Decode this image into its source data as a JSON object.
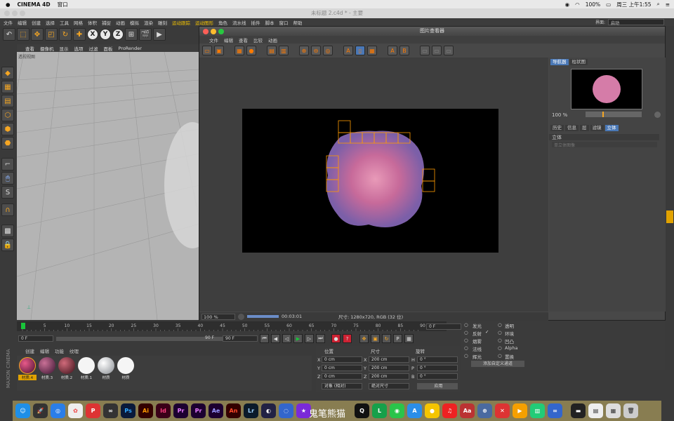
{
  "menubar": {
    "app": "CINEMA 4D",
    "window_menu": "窗口",
    "battery": "100%",
    "datetime": "周三 上午1:55"
  },
  "document_title": "未标题 2.c4d * - 主要",
  "c4d_menu": [
    "文件",
    "编辑",
    "创建",
    "选择",
    "工具",
    "网格",
    "体积",
    "捕捉",
    "动画",
    "模拟",
    "渲染",
    "雕刻",
    "运动跟踪",
    "运动图形",
    "角色",
    "流水线",
    "插件",
    "脚本",
    "窗口",
    "帮助"
  ],
  "layout": {
    "label": "界面:",
    "value": "启动"
  },
  "viewport": {
    "menu": [
      "查看",
      "摄像机",
      "显示",
      "选项",
      "过滤",
      "面板",
      "ProRender"
    ],
    "label": "透视视图"
  },
  "picture_viewer": {
    "title": "图片查看器",
    "menu": [
      "文件",
      "编辑",
      "查看",
      "比较",
      "动画"
    ],
    "zoom": "100 %",
    "time": "00:03:01",
    "size_info": "尺寸: 1280x720, RGB (32 位)",
    "nav_tabs": [
      "导航器",
      "柱状图"
    ],
    "nav_zoom": "100 %",
    "history_tabs": [
      "历史",
      "信息",
      "层",
      "滤镜",
      "立体"
    ],
    "stereo_label": "立体",
    "stereo_dropdown": "单立体图像"
  },
  "timeline": {
    "ticks": [
      "0",
      "5",
      "10",
      "15",
      "20",
      "25",
      "30",
      "35",
      "40",
      "45",
      "50",
      "55",
      "60",
      "65",
      "70",
      "75",
      "80",
      "85",
      "90"
    ],
    "current_frame": "0 F",
    "start_frame": "0 F",
    "end_frame_a": "90 F",
    "end_frame_b": "90 F"
  },
  "material_manager": {
    "menu": [
      "创建",
      "编辑",
      "功能",
      "纹理"
    ],
    "materials": [
      {
        "name": "材质.4",
        "color": "#c0392b"
      },
      {
        "name": "材质.3",
        "color": "#7b2a52"
      },
      {
        "name": "材质.2",
        "color": "#8a2f3c"
      },
      {
        "name": "材质.1",
        "color": "#f5f5f5"
      },
      {
        "name": "材质",
        "color": "#c8ccd2"
      },
      {
        "name": "材质",
        "color": "#f5f5f5"
      }
    ]
  },
  "coordinates": {
    "headers": [
      "位置",
      "尺寸",
      "旋转"
    ],
    "rows": [
      {
        "axis": "X",
        "pos": "0 cm",
        "size_axis": "X",
        "size": "200 cm",
        "rot_axis": "H",
        "rot": "0 °"
      },
      {
        "axis": "Y",
        "pos": "0 cm",
        "size_axis": "Y",
        "size": "200 cm",
        "rot_axis": "P",
        "rot": "0 °"
      },
      {
        "axis": "Z",
        "pos": "0 cm",
        "size_axis": "Z",
        "size": "200 cm",
        "rot_axis": "B",
        "rot": "0 °"
      }
    ],
    "mode": "对象 (相对)",
    "size_mode": "绝对尺寸",
    "apply": "应用"
  },
  "attributes": {
    "col1": [
      "发光",
      "反射",
      "烟雾",
      "法线",
      "辉光"
    ],
    "col2": [
      "透明",
      "环境",
      "凹凸",
      "Alpha",
      "置换"
    ],
    "custom_channel": "添加自定义通道"
  },
  "dock_watermark": "鬼笔熊猫"
}
